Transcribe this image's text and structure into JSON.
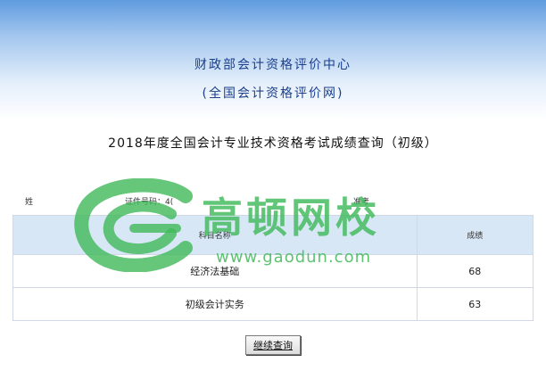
{
  "header": {
    "org_name": "财政部会计资格评价中心",
    "org_sub": "(全国会计资格评价网)",
    "heading": "2018年度全国会计专业技术资格考试成绩查询（初级）"
  },
  "candidate": {
    "name_label": "姓",
    "id_label": "证件号码：4(",
    "exam_no_label": "准考"
  },
  "table": {
    "headers": {
      "subject": "科目名称",
      "score": "成绩"
    },
    "rows": [
      {
        "subject": "经济法基础",
        "score": "68"
      },
      {
        "subject": "初级会计实务",
        "score": "63"
      }
    ]
  },
  "actions": {
    "continue_label": "继续查询"
  },
  "watermark": {
    "brand": "高顿网校",
    "url": "www.gaodun.com",
    "color": "#40b95a"
  }
}
